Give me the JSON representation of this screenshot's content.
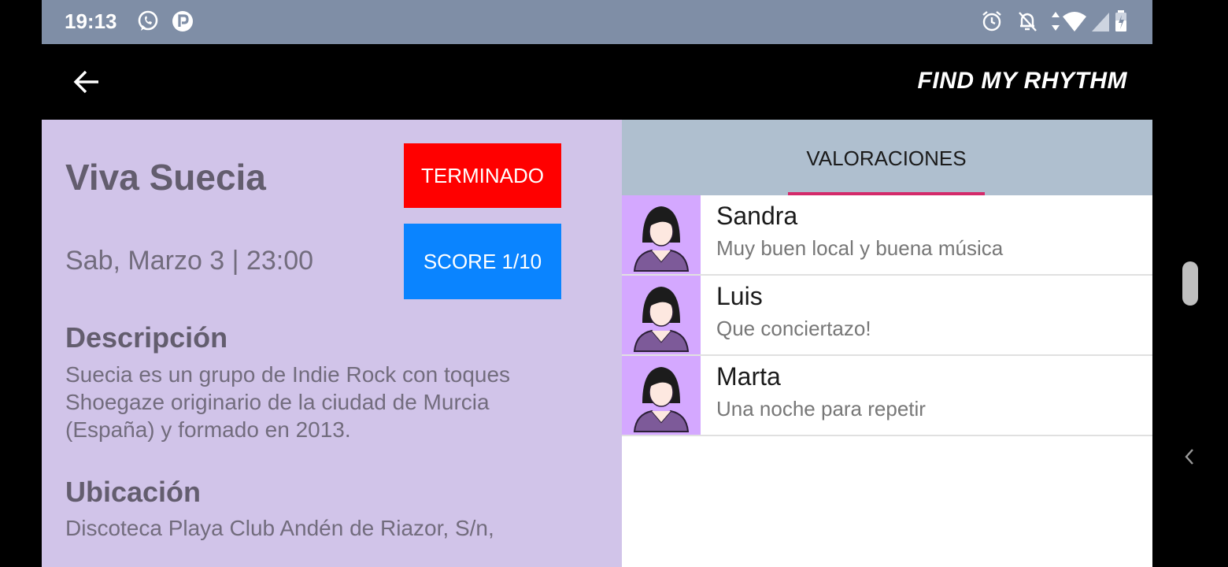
{
  "status": {
    "time": "19:13"
  },
  "appbar": {
    "title": "FIND MY RHYTHM"
  },
  "event": {
    "title": "Viva Suecia",
    "date": "Sab, Marzo 3 | 23:00",
    "status_badge": "TERMINADO",
    "score_badge": "SCORE 1/10",
    "description_title": "Descripción",
    "description_text": "Suecia es un grupo de Indie Rock con toques Shoegaze originario de la ciudad de Murcia (España) y formado en 2013.",
    "location_title": "Ubicación",
    "location_text": "Discoteca Playa Club Andén de Riazor, S/n,"
  },
  "tabs": [
    {
      "label": "VALORACIONES",
      "selected": true
    }
  ],
  "reviews": [
    {
      "name": "Sandra",
      "text": "Muy buen local y buena música"
    },
    {
      "name": "Luis",
      "text": "Que conciertazo!"
    },
    {
      "name": "Marta",
      "text": "Una noche para repetir"
    }
  ],
  "colors": {
    "status_badge": "#ff0000",
    "score_badge": "#0a84ff",
    "left_panel": "#d1c4e9",
    "tab_bar": "#afbfcf",
    "tab_indicator": "#d42a6a",
    "avatar_bg": "#d4a8ff"
  },
  "icons": {
    "status": [
      "whatsapp-icon",
      "parking-icon",
      "alarm-icon",
      "bell-off-icon",
      "data-arrows-icon",
      "wifi-icon",
      "signal-icon",
      "battery-icon"
    ],
    "nav": "back-arrow-icon",
    "avatar": "user-avatar-icon"
  }
}
